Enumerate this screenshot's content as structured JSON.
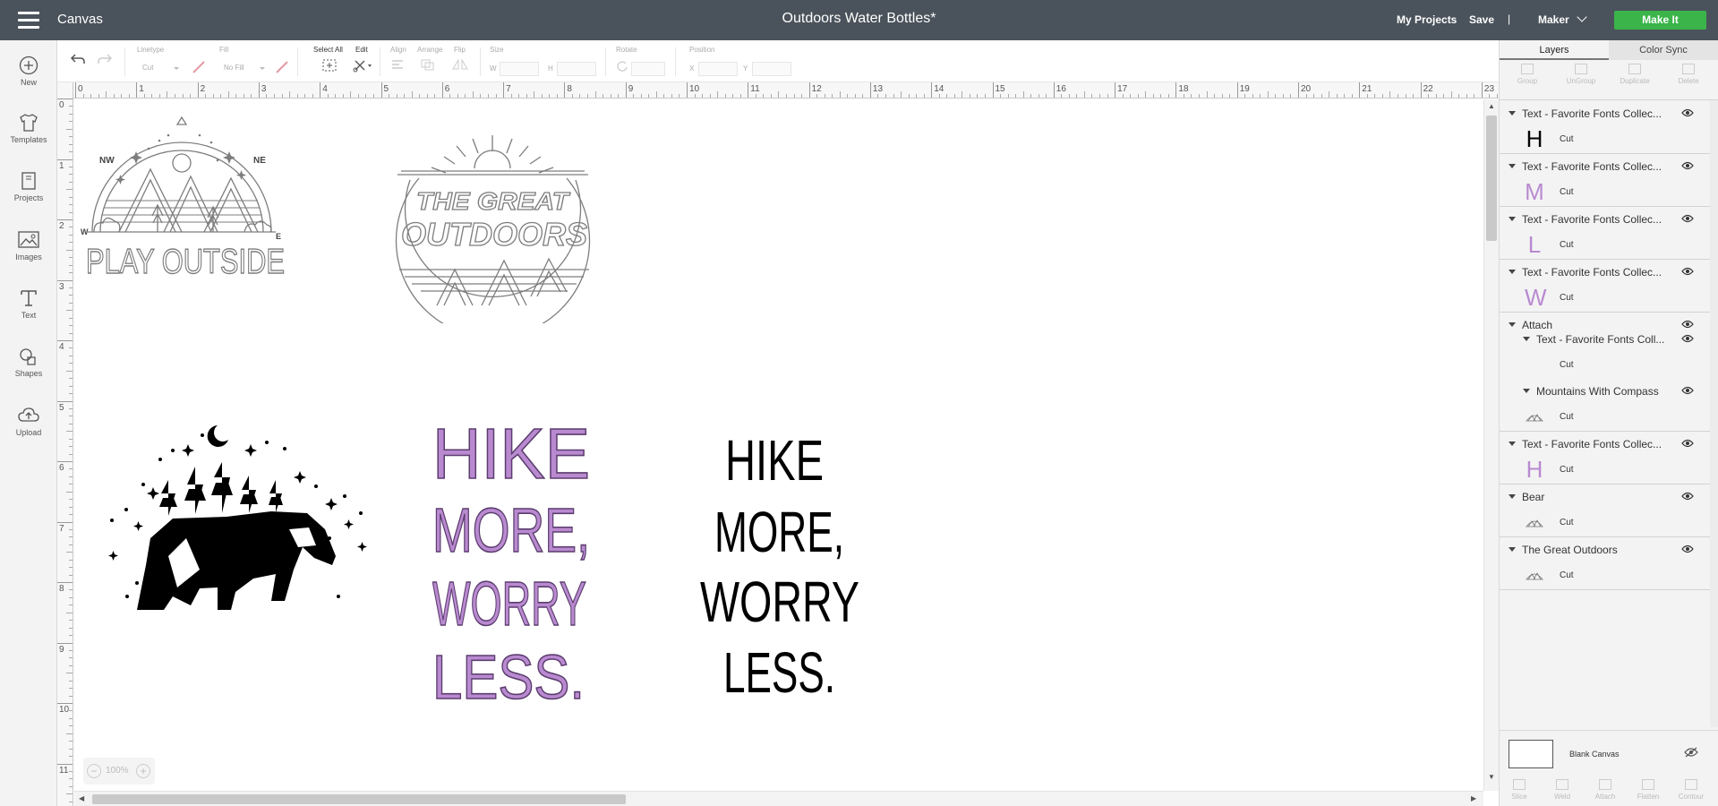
{
  "topbar": {
    "app_title": "Canvas",
    "doc_title": "Outdoors Water Bottles*",
    "my_projects": "My Projects",
    "save": "Save",
    "separator": "|",
    "machine": "Maker",
    "make_it": "Make It"
  },
  "left_nav": [
    {
      "label": "New",
      "icon": "plus-circle-icon"
    },
    {
      "label": "Templates",
      "icon": "tshirt-icon"
    },
    {
      "label": "Projects",
      "icon": "book-icon"
    },
    {
      "label": "Images",
      "icon": "image-icon"
    },
    {
      "label": "Text",
      "icon": "text-T-icon"
    },
    {
      "label": "Shapes",
      "icon": "shapes-icon"
    },
    {
      "label": "Upload",
      "icon": "cloud-upload-icon"
    }
  ],
  "toolbar": {
    "linetype_label": "Linetype",
    "linetype_value": "Cut",
    "fill_label": "Fill",
    "fill_value": "No Fill",
    "select_all": "Select All",
    "edit": "Edit",
    "align": "Align",
    "arrange": "Arrange",
    "flip": "Flip",
    "size": "Size",
    "w": "W",
    "h": "H",
    "rotate": "Rotate",
    "position": "Position",
    "x": "X",
    "y": "Y"
  },
  "ruler": {
    "h_ticks": [
      "0",
      "1",
      "2",
      "3",
      "4",
      "5",
      "6",
      "7",
      "8",
      "9",
      "10",
      "11",
      "12",
      "13",
      "14",
      "15",
      "16",
      "17",
      "18",
      "19",
      "20",
      "21",
      "22",
      "23"
    ],
    "v_ticks": [
      "0",
      "1",
      "2",
      "3",
      "4",
      "5",
      "6",
      "7",
      "8",
      "9",
      "10",
      "11"
    ]
  },
  "canvas": {
    "play_outside": "PLAY OUTSIDE",
    "compass_nw": "NW",
    "compass_ne": "NE",
    "compass_w": "W",
    "compass_e": "E",
    "great_outdoors_1": "THE GREAT",
    "great_outdoors_2": "OUTDOORS",
    "hike_lines": [
      "HIKE",
      "MORE,",
      "WORRY",
      "LESS."
    ],
    "purple": "#b98ad0",
    "black": "#000000",
    "outline": "#8a8a8a"
  },
  "zoom": {
    "value": "100%",
    "minus": "−",
    "plus": "+"
  },
  "panel": {
    "tab_layers": "Layers",
    "tab_colorsync": "Color Sync",
    "actions": [
      "Group",
      "UnGroup",
      "Duplicate",
      "Delete"
    ],
    "layers": [
      {
        "name": "Text - Favorite Fonts Collec...",
        "thumb": "H",
        "op": "Cut",
        "thumb_color": "#000000"
      },
      {
        "name": "Text - Favorite Fonts Collec...",
        "thumb": "M",
        "op": "Cut",
        "thumb_color": "#b98ad0"
      },
      {
        "name": "Text - Favorite Fonts Collec...",
        "thumb": "L",
        "op": "Cut",
        "thumb_color": "#b98ad0"
      },
      {
        "name": "Text - Favorite Fonts Collec...",
        "thumb": "W",
        "op": "Cut",
        "thumb_color": "#b98ad0"
      }
    ],
    "attach": {
      "name": "Attach",
      "children": [
        {
          "name": "Text - Favorite Fonts Coll...",
          "op": "Cut"
        },
        {
          "name": "Mountains With Compass",
          "op": "Cut"
        }
      ]
    },
    "layers2": [
      {
        "name": "Text - Favorite Fonts Collec...",
        "thumb": "H",
        "op": "Cut",
        "thumb_color": "#b98ad0"
      },
      {
        "name": "Bear",
        "op": "Cut"
      },
      {
        "name": "The Great Outdoors",
        "op": "Cut"
      }
    ],
    "blank_canvas": "Blank Canvas",
    "bottom_actions": [
      "Slice",
      "Weld",
      "Attach",
      "Flatten",
      "Contour"
    ]
  }
}
